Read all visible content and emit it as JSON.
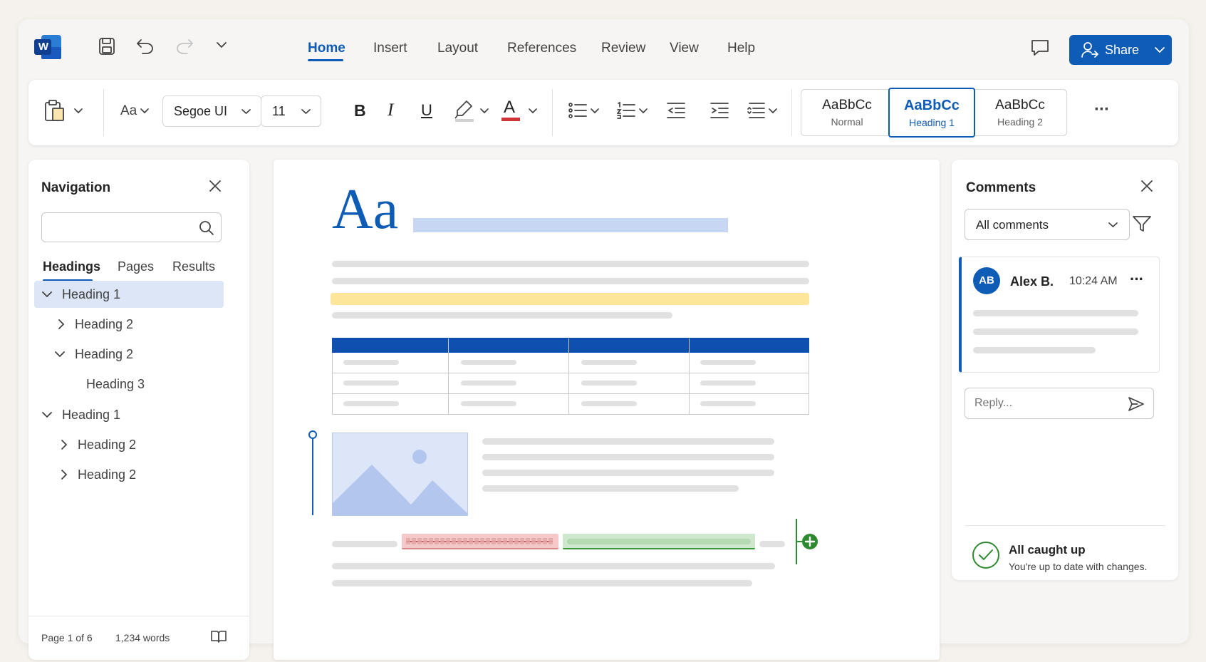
{
  "app": {
    "logo_letter": "W"
  },
  "tabs": [
    "Home",
    "Insert",
    "Layout",
    "References",
    "Review",
    "View",
    "Help"
  ],
  "share_label": "Share",
  "ribbon": {
    "font_size_control": "Aa",
    "font_name": "Segoe UI",
    "font_size": "11",
    "bold": "B",
    "italic": "I",
    "underline": "U",
    "font_color_letter": "A",
    "styles": [
      {
        "sample": "AaBbCc",
        "name": "Normal"
      },
      {
        "sample": "AaBbCc",
        "name": "Heading 1"
      },
      {
        "sample": "AaBbCc",
        "name": "Heading 2"
      }
    ],
    "more": "···"
  },
  "navigation": {
    "title": "Navigation",
    "search_placeholder": "",
    "tabs": [
      "Headings",
      "Pages",
      "Results"
    ],
    "items": [
      {
        "label": "Heading 1",
        "level": 1,
        "chevron": "down",
        "selected": true
      },
      {
        "label": "Heading 2",
        "level": 2,
        "chevron": "right"
      },
      {
        "label": "Heading 2",
        "level": 2,
        "chevron": "down"
      },
      {
        "label": "Heading 3",
        "level": 3,
        "chevron": "none"
      },
      {
        "label": "Heading 1",
        "level": 1,
        "chevron": "down"
      },
      {
        "label": "Heading 2",
        "level": 2,
        "chevron": "right"
      },
      {
        "label": "Heading 2",
        "level": 2,
        "chevron": "right"
      }
    ],
    "status_page": "Page 1 of 6",
    "status_words": "1,234 words"
  },
  "document": {
    "title_sample": "Aa"
  },
  "comments": {
    "title": "Comments",
    "filter_value": "All comments",
    "comment": {
      "initials": "AB",
      "author": "Alex B.",
      "time": "10:24 AM",
      "more": "···"
    },
    "reply_placeholder": "Reply...",
    "caught_up_title": "All caught up",
    "caught_up_sub": "You're up to date with changes."
  },
  "colors": {
    "accent": "#0f5cb6",
    "highlight": "#fde59a",
    "deleted": "#f5c9c9",
    "inserted": "#cfe8cd",
    "placeholder_bar": "#c7d7f3"
  }
}
